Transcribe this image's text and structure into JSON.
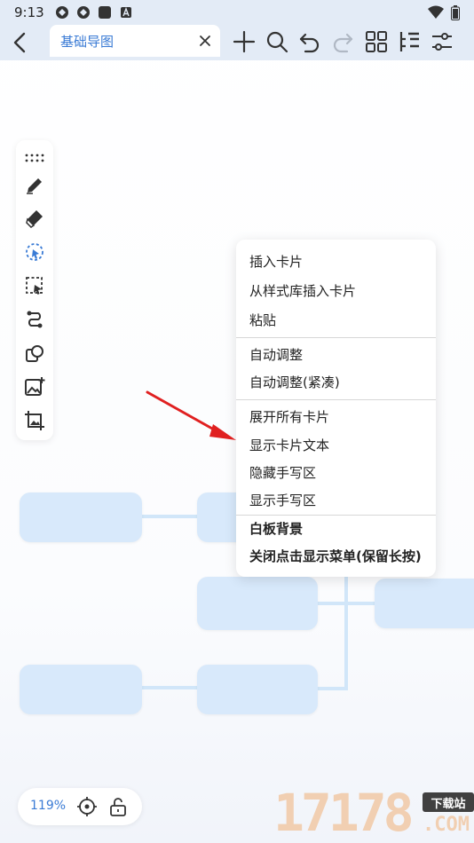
{
  "status_bar": {
    "time": "9:13"
  },
  "tab": {
    "title": "基础导图"
  },
  "context_menu": {
    "items": [
      "插入卡片",
      "从样式库插入卡片",
      "粘贴",
      "自动调整",
      "自动调整(紧凑)",
      "展开所有卡片",
      "显示卡片文本",
      "隐藏手写区",
      "显示手写区",
      "白板背景",
      "关闭点击显示菜单(保留长按)"
    ]
  },
  "zoom": {
    "level": "119%"
  },
  "watermark": {
    "digits": "17178",
    "badge": "下载站",
    "suffix": ".COM"
  },
  "colors": {
    "accent": "#3a7bd5",
    "node": "#d8e9fb",
    "arrow": "#e02020"
  }
}
